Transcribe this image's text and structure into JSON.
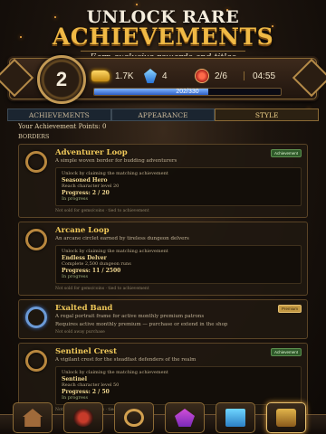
{
  "header": {
    "title_line1": "Unlock Rare",
    "title_line2": "Achievements",
    "subtitle": "Earn exclusive rewards and titles"
  },
  "status": {
    "level": "2",
    "gold": "1.7K",
    "gems": "4",
    "achievements": "2/6",
    "timer": "04:55",
    "xp_text": "202/330",
    "xp_fraction": 0.61
  },
  "tabs": [
    {
      "label": "Achievements",
      "active": false
    },
    {
      "label": "Appearance",
      "active": false
    },
    {
      "label": "Style",
      "active": true
    }
  ],
  "panel": {
    "points_label": "Your Achievement Points: 0",
    "section_label": "Borders",
    "cards": [
      {
        "title": "Adventurer Loop",
        "description": "A simple woven border for budding adventurers",
        "badge": "Achievement",
        "unlock_text": "Unlock by claiming the matching achievement",
        "requirement": "Seasoned Hero",
        "requirement_desc": "Reach character level 20",
        "progress": "Progress: 2 / 20",
        "status": "In progress",
        "note": "Not sold for gems/coins · tied to achievement"
      },
      {
        "title": "Arcane Loop",
        "description": "An arcane circlet earned by tireless dungeon delvers",
        "badge": "",
        "unlock_text": "Unlock by claiming the matching achievement",
        "requirement": "Endless Delver",
        "requirement_desc": "Complete 2,500 dungeon runs",
        "progress": "Progress: 11 / 2500",
        "status": "In progress",
        "note": "Not sold for gems/coins · tied to achievement"
      },
      {
        "title": "Exalted Band",
        "description": "A regal portrait frame for active monthly premium patrons",
        "badge": "Premium",
        "unlock_text": "Requires active monthly premium — purchase or extend in the shop",
        "note": "Not sold away purchase"
      },
      {
        "title": "Sentinel Crest",
        "description": "A vigilant crest for the steadfast defenders of the realm",
        "badge": "Achievement",
        "unlock_text": "Unlock by claiming the matching achievement",
        "requirement": "Sentinel",
        "requirement_desc": "Reach character level 50",
        "progress": "Progress: 2 / 50",
        "status": "In progress",
        "note": "Not sold for gems/coins · tied to achievement"
      }
    ]
  },
  "nav": {
    "items": [
      "house-icon",
      "demon-icon",
      "ring-icon",
      "gem-icon",
      "book-icon",
      "chest-icon"
    ],
    "active_index": 5
  },
  "colors": {
    "accent_gold": "#f0b945",
    "xp_blue": "#2f5fc4",
    "achievement_badge": "#2f5a2a",
    "premium_badge": "#c49a44"
  }
}
